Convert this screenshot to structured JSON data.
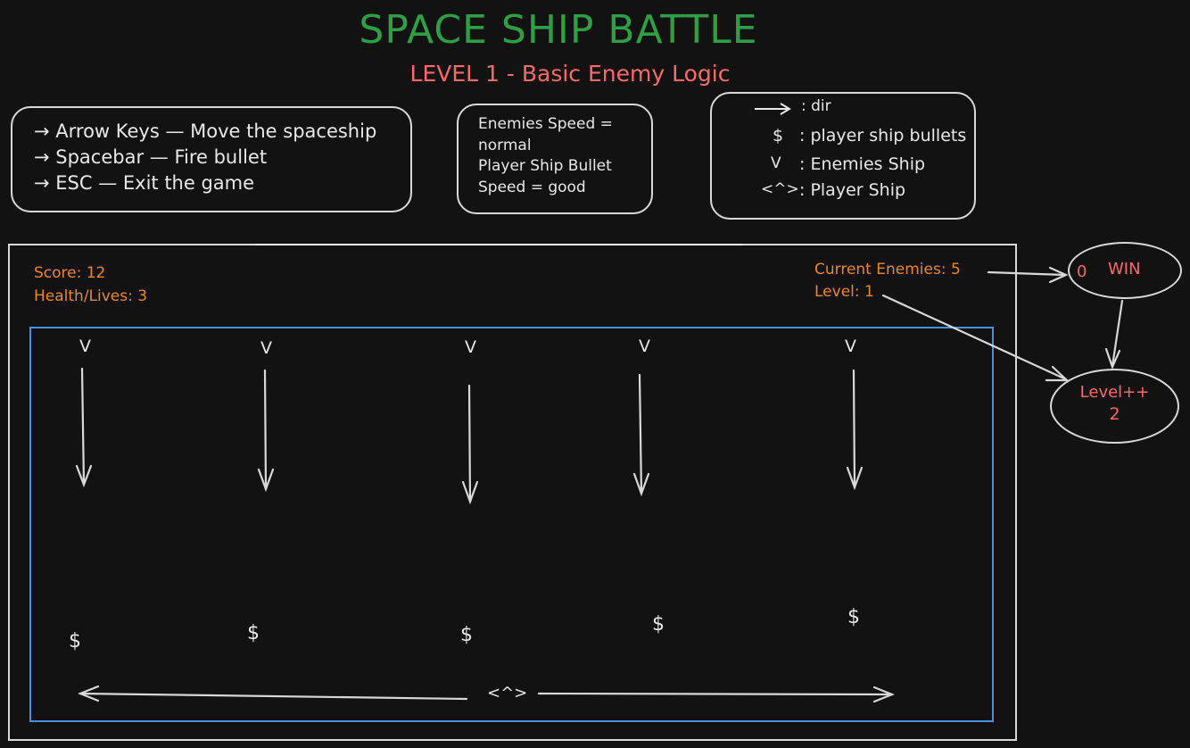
{
  "title": "SPACE SHIP BATTLE",
  "subtitle": "LEVEL 1 - Basic Enemy Logic",
  "controls": [
    "→ Arrow Keys — Move the spaceship",
    "→ Spacebar — Fire bullet",
    "→ ESC — Exit the game"
  ],
  "speeds": [
    "Enemies Speed =",
    "normal",
    "Player Ship Bullet",
    "Speed = good"
  ],
  "legend": {
    "dir_label": ":  dir",
    "bullet_symbol": "$",
    "bullet_label": ":  player ship bullets",
    "enemy_symbol": "V",
    "enemy_label": ":  Enemies Ship",
    "player_symbol": "<^>",
    "player_label": ":  Player Ship"
  },
  "hud": {
    "score": "Score: 12",
    "health": "Health/Lives: 3",
    "current_enemies": "Current Enemies: 5",
    "level": "Level: 1"
  },
  "game": {
    "enemy_glyph": "V",
    "enemies": [
      "V",
      "V",
      "V",
      "V",
      "V"
    ],
    "bullets": [
      "$",
      "$",
      "$",
      "$",
      "$"
    ],
    "player_glyph": "<^>"
  },
  "flow": {
    "win_zero": "0",
    "win_label": "WIN",
    "level_up_label": "Level++",
    "level_up_value": "2"
  },
  "colors": {
    "background": "#121212",
    "title": "#2f9e44",
    "subtitle": "#ff6b6b",
    "hud": "#e8892f",
    "playfield_border": "#4a90d9",
    "stroke": "#d8d8d8"
  }
}
